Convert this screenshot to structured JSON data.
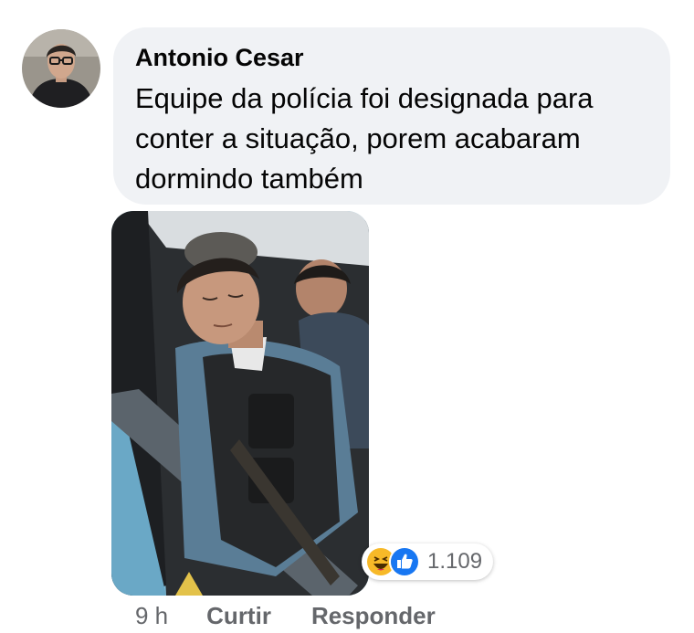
{
  "comment": {
    "author": "Antonio Cesar",
    "text": "Equipe da polícia foi designada para conter a situação, porem acabaram dormindo também",
    "time": "9 h",
    "actions": {
      "like": "Curtir",
      "reply": "Responder"
    },
    "reactions": {
      "count": "1.109",
      "types": [
        "haha-icon",
        "like-icon"
      ]
    }
  },
  "colors": {
    "bubble": "#f0f2f5",
    "text": "#050505",
    "secondary_text": "#65676b",
    "like_blue": "#1877f2",
    "haha_yellow": "#f7b928"
  }
}
